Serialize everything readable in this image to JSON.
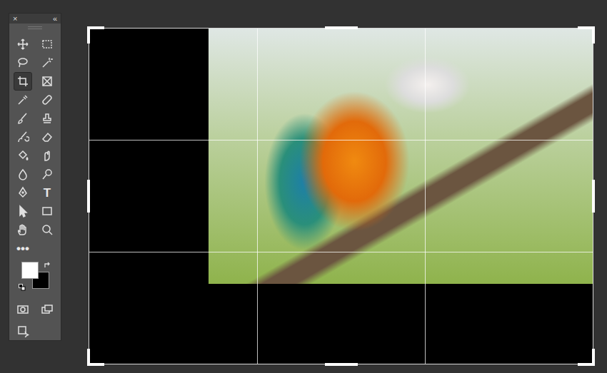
{
  "panel": {
    "close": "×",
    "collapse": "«"
  },
  "tools": [
    {
      "kind": "move",
      "selected": false
    },
    {
      "kind": "marquee",
      "selected": false
    },
    {
      "kind": "lasso",
      "selected": false
    },
    {
      "kind": "wand",
      "selected": false
    },
    {
      "kind": "crop",
      "selected": true
    },
    {
      "kind": "frame",
      "selected": false
    },
    {
      "kind": "eyedropper",
      "selected": false
    },
    {
      "kind": "healing",
      "selected": false
    },
    {
      "kind": "brush",
      "selected": false
    },
    {
      "kind": "stamp",
      "selected": false
    },
    {
      "kind": "history",
      "selected": false
    },
    {
      "kind": "eraser",
      "selected": false
    },
    {
      "kind": "bucket",
      "selected": false
    },
    {
      "kind": "smudge",
      "selected": false
    },
    {
      "kind": "blur",
      "selected": false
    },
    {
      "kind": "dodge",
      "selected": false
    },
    {
      "kind": "pen",
      "selected": false
    },
    {
      "kind": "type",
      "selected": false,
      "label": "T"
    },
    {
      "kind": "select",
      "selected": false
    },
    {
      "kind": "rectangle",
      "selected": false
    },
    {
      "kind": "hand",
      "selected": false
    },
    {
      "kind": "zoom",
      "selected": false
    },
    {
      "kind": "more",
      "selected": false,
      "label": "•••"
    }
  ],
  "swatches": {
    "foreground": {
      "color": "#ffffff"
    },
    "background": {
      "color": "#000000"
    }
  },
  "bottom_tools": [
    {
      "kind": "quickmask",
      "selected": false
    },
    {
      "kind": "screenmode",
      "selected": false
    },
    {
      "kind": "generate",
      "selected": false
    }
  ]
}
